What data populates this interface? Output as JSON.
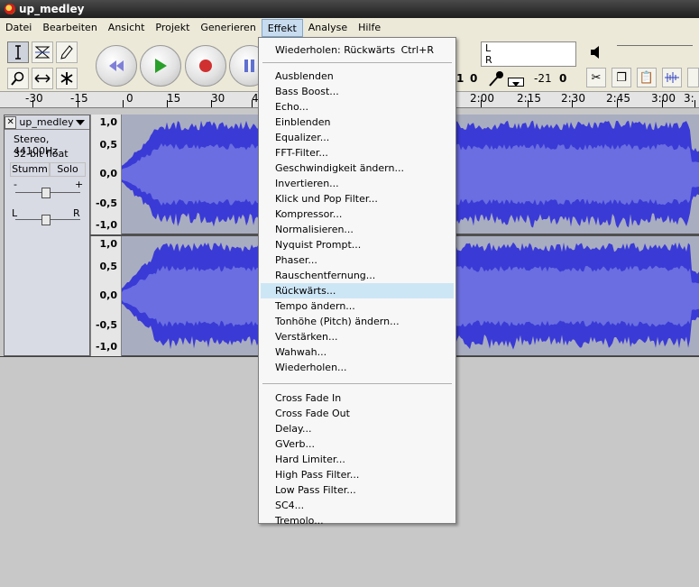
{
  "window": {
    "title": "up_medley"
  },
  "menubar": [
    "Datei",
    "Bearbeiten",
    "Ansicht",
    "Projekt",
    "Generieren",
    "Effekt",
    "Analyse",
    "Hilfe"
  ],
  "toolbar": {
    "meter_lr": [
      "L",
      "R"
    ],
    "meter_readouts": [
      "1",
      "0",
      "-21",
      "0"
    ]
  },
  "ruler": {
    "ticks": [
      "-30",
      "-15",
      "0",
      "15",
      "30",
      "4",
      "2:00",
      "2:15",
      "2:30",
      "2:45",
      "3:00",
      "3:"
    ]
  },
  "track": {
    "name": "up_medley",
    "format": "Stereo, 44100Hz",
    "bits": "32-bit float",
    "mute": "Stumm",
    "solo": "Solo",
    "gain_minus": "-",
    "gain_plus": "+",
    "pan_left": "L",
    "pan_right": "R",
    "scale_labels": [
      "1,0",
      "0,5",
      "0,0",
      "-0,5",
      "-1,0"
    ]
  },
  "effect_menu": {
    "repeat_label": "Wiederholen: Rückwärts",
    "repeat_shortcut": "Ctrl+R",
    "group1": [
      "Ausblenden",
      "Bass Boost...",
      "Echo...",
      "Einblenden",
      "Equalizer...",
      "FFT-Filter...",
      "Geschwindigkeit ändern...",
      "Invertieren...",
      "Klick und Pop Filter...",
      "Kompressor...",
      "Normalisieren...",
      "Nyquist Prompt...",
      "Phaser...",
      "Rauschentfernung...",
      "Rückwärts...",
      "Tempo ändern...",
      "Tonhöhe (Pitch) ändern...",
      "Verstärken...",
      "Wahwah...",
      "Wiederholen..."
    ],
    "group2": [
      "Cross Fade In",
      "Cross Fade Out",
      "Delay...",
      "GVerb...",
      "Hard Limiter...",
      "High Pass Filter...",
      "Low Pass Filter...",
      "SC4...",
      "Tremolo..."
    ],
    "highlighted": "Rückwärts..."
  },
  "colors": {
    "wave_outer": "#3a3ad6",
    "wave_inner": "#6a6ee0",
    "wave_bg": "#a9adc0",
    "menu_highlight": "#cde6f6"
  }
}
